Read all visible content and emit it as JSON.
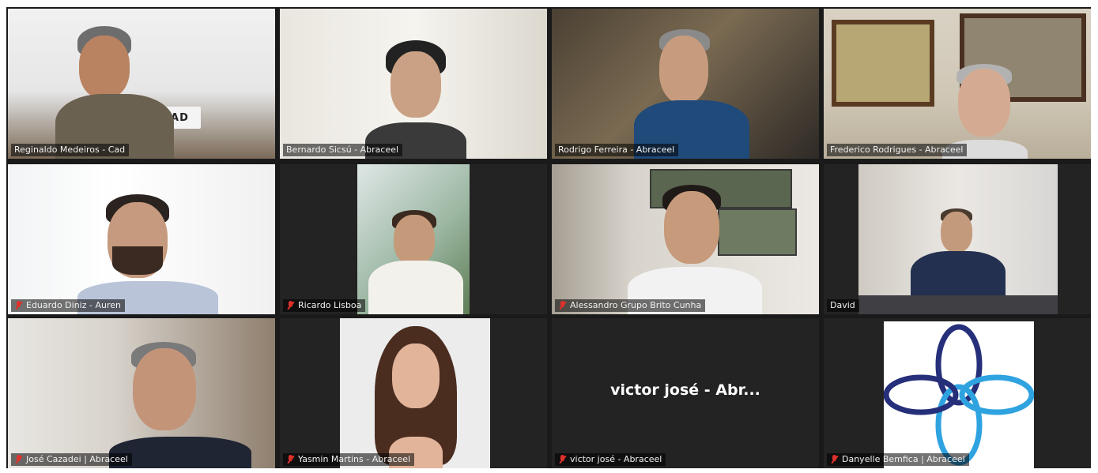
{
  "meeting": {
    "participants": [
      {
        "name": "Reginaldo Medeiros - Cad",
        "muted": false,
        "active": false
      },
      {
        "name": "Bernardo Sicsú - Abraceel",
        "muted": false,
        "active": false
      },
      {
        "name": "Rodrigo Ferreira - Abraceel",
        "muted": false,
        "active": true
      },
      {
        "name": "Frederico Rodrigues - Abraceel",
        "muted": false,
        "active": false
      },
      {
        "name": "Eduardo Diniz - Auren",
        "muted": true,
        "active": false
      },
      {
        "name": "Ricardo Lisboa",
        "muted": true,
        "active": false
      },
      {
        "name": "Alessandro Grupo Brito Cunha",
        "muted": true,
        "active": false
      },
      {
        "name": "David",
        "muted": false,
        "active": false
      },
      {
        "name": "José Cazadei | Abraceel",
        "muted": true,
        "active": false
      },
      {
        "name": "Yasmin Martins - Abraceel",
        "muted": true,
        "active": false
      },
      {
        "name": "victor josé - Abraceel",
        "muted": true,
        "active": false,
        "video_off_label": "victor josé - Abr..."
      },
      {
        "name": "Danyelle Bemfica | Abraceel",
        "muted": true,
        "active": false
      }
    ],
    "background_sign": "RAD"
  },
  "colors": {
    "active_border": "#c9dd5a",
    "muted_icon": "#e0312b",
    "tile_background": "#232323"
  }
}
